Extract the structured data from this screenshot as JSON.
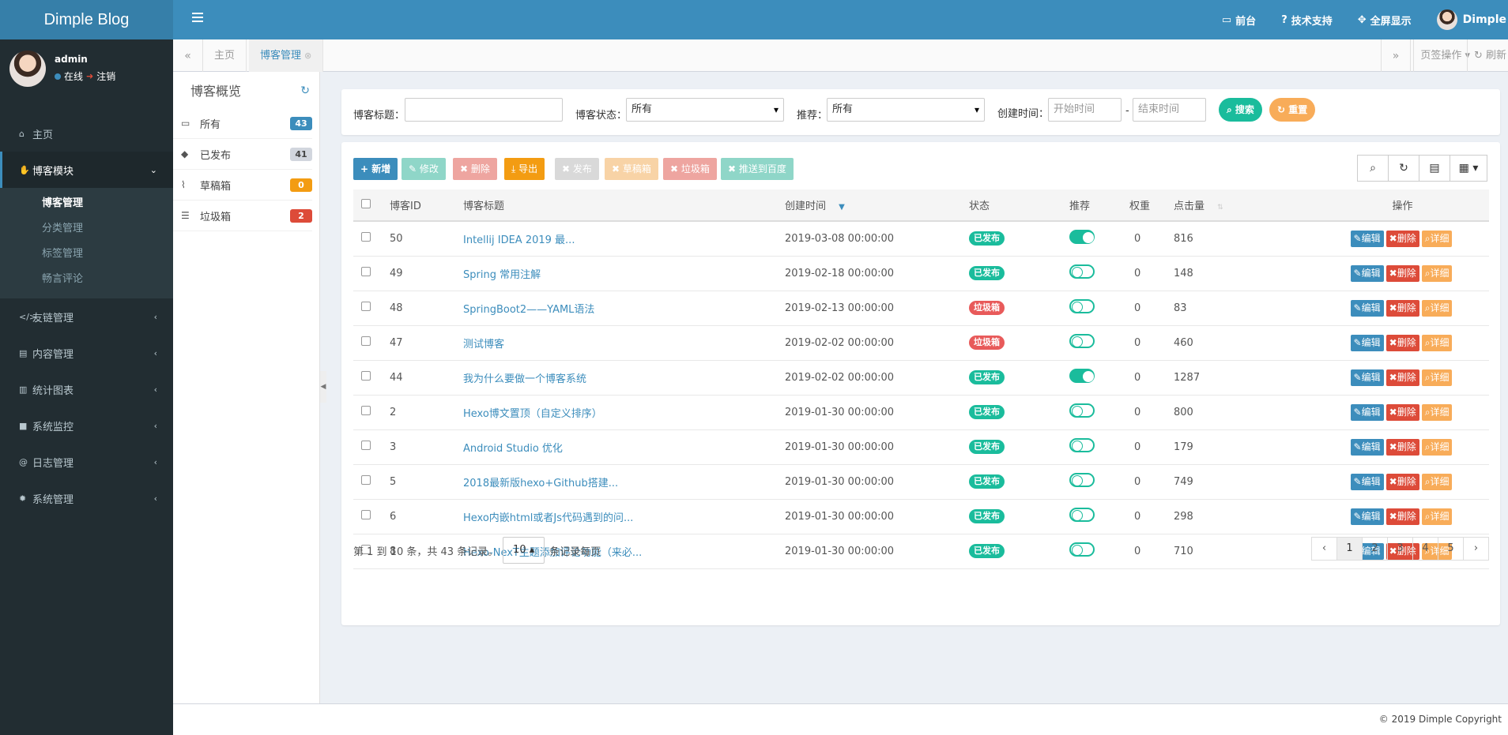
{
  "app": {
    "title": "Dimple Blog"
  },
  "topnav": {
    "frontend": "前台",
    "support": "技术支持",
    "fullscreen": "全屏显示",
    "username": "Dimple"
  },
  "user": {
    "name": "admin",
    "status": "在线",
    "logout": "注销"
  },
  "sidebar": {
    "home": "主页",
    "blog_module": "博客模块",
    "blog_sub": [
      "博客管理",
      "分类管理",
      "标签管理",
      "畅言评论"
    ],
    "others": [
      "友链管理",
      "内容管理",
      "统计图表",
      "系统监控",
      "日志管理",
      "系统管理"
    ]
  },
  "tabs": {
    "home": "主页",
    "active": "博客管理",
    "page_ops": "页签操作",
    "refresh": "刷新"
  },
  "overview": {
    "title": "博客概览",
    "items": [
      {
        "label": "所有",
        "count": "43",
        "color": "#3c8dbc"
      },
      {
        "label": "已发布",
        "count": "41",
        "color": "#d2d6de"
      },
      {
        "label": "草稿箱",
        "count": "0",
        "color": "#f39c12"
      },
      {
        "label": "垃圾箱",
        "count": "2",
        "color": "#dd4b39"
      }
    ]
  },
  "search": {
    "title_label": "博客标题：",
    "status_label": "博客状态：",
    "status_value": "所有",
    "recommend_label": "推荐：",
    "recommend_value": "所有",
    "time_label": "创建时间：",
    "start_placeholder": "开始时间",
    "sep": "-",
    "end_placeholder": "结束时间",
    "search_btn": "搜索",
    "reset_btn": "重置"
  },
  "toolbar": {
    "add": "新增",
    "edit": "修改",
    "delete": "删除",
    "export": "导出",
    "publish": "发布",
    "draft": "草稿箱",
    "trash": "垃圾箱",
    "baidu": "推送到百度"
  },
  "table": {
    "headers": [
      "博客ID",
      "博客标题",
      "创建时间",
      "状态",
      "推荐",
      "权重",
      "点击量",
      "操作"
    ],
    "actions": {
      "edit": "编辑",
      "delete": "删除",
      "detail": "详细"
    },
    "rows": [
      {
        "id": "50",
        "title": "Intellij IDEA 2019 最...",
        "time": "2019-03-08 00:00:00",
        "status": "已发布",
        "recommend": true,
        "weight": "0",
        "clicks": "816"
      },
      {
        "id": "49",
        "title": "Spring 常用注解",
        "time": "2019-02-18 00:00:00",
        "status": "已发布",
        "recommend": false,
        "weight": "0",
        "clicks": "148"
      },
      {
        "id": "48",
        "title": "SpringBoot2——YAML语法",
        "time": "2019-02-13 00:00:00",
        "status": "垃圾箱",
        "recommend": false,
        "weight": "0",
        "clicks": "83"
      },
      {
        "id": "47",
        "title": "测试博客",
        "time": "2019-02-02 00:00:00",
        "status": "垃圾箱",
        "recommend": false,
        "weight": "0",
        "clicks": "460"
      },
      {
        "id": "44",
        "title": "我为什么要做一个博客系统",
        "time": "2019-02-02 00:00:00",
        "status": "已发布",
        "recommend": true,
        "weight": "0",
        "clicks": "1287"
      },
      {
        "id": "2",
        "title": "Hexo博文置顶（自定义排序）",
        "time": "2019-01-30 00:00:00",
        "status": "已发布",
        "recommend": false,
        "weight": "0",
        "clicks": "800"
      },
      {
        "id": "3",
        "title": "Android Studio 优化",
        "time": "2019-01-30 00:00:00",
        "status": "已发布",
        "recommend": false,
        "weight": "0",
        "clicks": "179"
      },
      {
        "id": "5",
        "title": "2018最新版hexo+Github搭建...",
        "time": "2019-01-30 00:00:00",
        "status": "已发布",
        "recommend": false,
        "weight": "0",
        "clicks": "749"
      },
      {
        "id": "6",
        "title": "Hexo内嵌html或者Js代码遇到的问...",
        "time": "2019-01-30 00:00:00",
        "status": "已发布",
        "recommend": false,
        "weight": "0",
        "clicks": "298"
      },
      {
        "id": "8",
        "title": "Hexo-NexT主题添加评论功能（来必...",
        "time": "2019-01-30 00:00:00",
        "status": "已发布",
        "recommend": false,
        "weight": "0",
        "clicks": "710"
      }
    ]
  },
  "pagination": {
    "summary": "第 1 到 10 条，共 43 条记录。",
    "page_size": "10",
    "page_size_suffix": "条记录每页",
    "prev": "‹",
    "next": "›",
    "pages": [
      "1",
      "2",
      "3",
      "4",
      "5"
    ],
    "current": "1"
  },
  "footer": {
    "copyright": "© 2019 Dimple Copyright"
  },
  "colors": {
    "primary": "#3c8dbc",
    "success": "#00a65a",
    "teal": "#1abc9c",
    "danger": "#dd4b39",
    "warning": "#f39c12"
  }
}
